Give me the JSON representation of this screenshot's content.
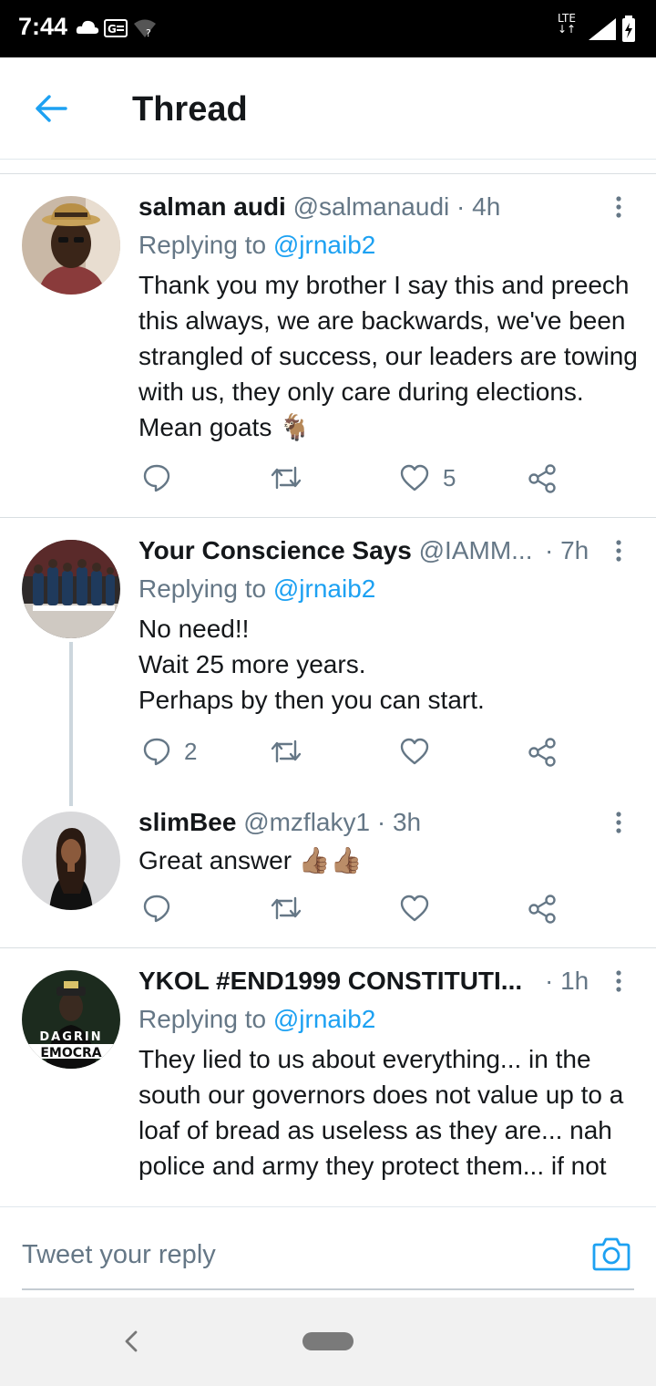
{
  "status_bar": {
    "time": "7:44",
    "network": "LTE"
  },
  "header": {
    "title": "Thread",
    "back_icon": "arrow-left-icon"
  },
  "tweets": [
    {
      "name": "salman audi",
      "handle": "@salmanaudi",
      "time": "· 4h",
      "replying_prefix": "Replying to",
      "replying_to": "@jrnaib2",
      "text": "Thank you my brother I say this and preech this always, we are backwards, we've been strangled of success, our leaders are towing with us, they only care during elections. Mean goats 🐐",
      "likes": "5",
      "replies": "",
      "retweets": ""
    },
    {
      "name": "Your Conscience Says",
      "handle": "@IAMM...",
      "time": "· 7h",
      "replying_prefix": "Replying to",
      "replying_to": "@jrnaib2",
      "lines": [
        "No need!!",
        "Wait 25 more years.",
        "Perhaps by then you can start."
      ],
      "replies": "2",
      "likes": ""
    },
    {
      "name": "slimBee",
      "handle": "@mzflaky1",
      "time": "· 3h",
      "text": "Great answer 👍🏽👍🏽"
    },
    {
      "name": "YKOL #END1999 CONSTITUTI...",
      "handle": "",
      "time": "· 1h",
      "replying_prefix": "Replying to",
      "replying_to": "@jrnaib2",
      "avatar_text_top": "DAGRIN",
      "avatar_text_bottom": "EMOCRA",
      "text": "They lied to us about everything... in the south our governors does not value up to a loaf of bread as useless as they are... nah police and army they protect them... if not"
    }
  ],
  "reply_bar": {
    "placeholder": "Tweet your reply",
    "camera_icon": "camera-icon"
  },
  "colors": {
    "accent": "#1da1f2",
    "secondary_text": "#657786",
    "icon_gray": "#657786"
  }
}
